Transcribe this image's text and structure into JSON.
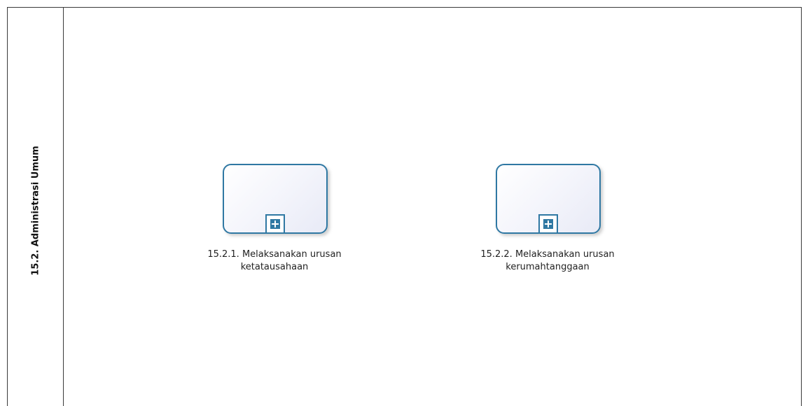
{
  "lane": {
    "title": "15.2. Administrasi Umum"
  },
  "tasks": [
    {
      "line1": "15.2.1. Melaksanakan urusan",
      "line2": "ketatausahaan",
      "marker_icon": "plus-icon"
    },
    {
      "line1": "15.2.2. Melaksanakan urusan",
      "line2": "kerumahtanggaan",
      "marker_icon": "plus-icon"
    }
  ],
  "colors": {
    "task_border": "#2f78a3",
    "lane_border": "#3a3a3a"
  }
}
